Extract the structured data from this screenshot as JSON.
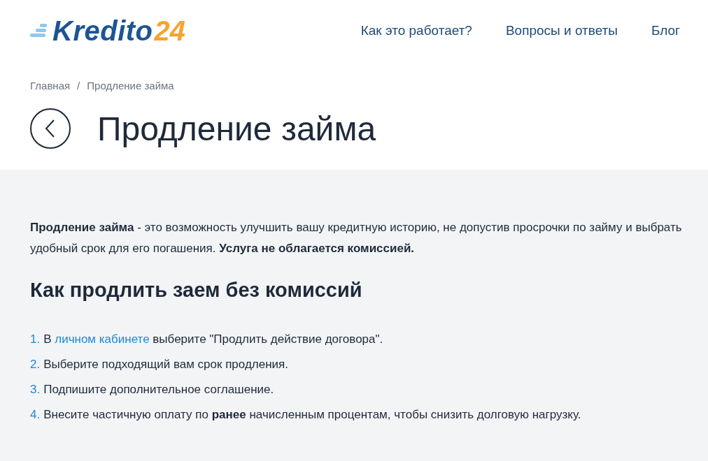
{
  "logo": {
    "word": "Kredito",
    "number": "24"
  },
  "nav": [
    "Как это работает?",
    "Вопросы и ответы",
    "Блог"
  ],
  "breadcrumbs": [
    {
      "label": "Главная"
    },
    {
      "label": "Продление займа"
    }
  ],
  "breadcrumb_separator": "/",
  "title": "Продление займа",
  "intro": "**Продление займа** - это возможность улучшить вашу кредитную историю, не допустив просрочки по займу и выбрать удобный срок для его погашения. **Услуга не облагается комиссией.**",
  "heading": "Как продлить заем без комиссий",
  "steps": [
    {
      "number": "1.",
      "parts": [
        {
          "kind": "text",
          "text": "В "
        },
        {
          "kind": "link",
          "text": "личном кабинете"
        },
        {
          "kind": "text",
          "text": " выберите \"Продлить действие договора\"."
        }
      ]
    },
    {
      "number": "2.",
      "parts": [
        {
          "kind": "text",
          "text": "Выберите подходящий вам срок продления."
        }
      ]
    },
    {
      "number": "3.",
      "parts": [
        {
          "kind": "text",
          "text": "Подпишите дополнительное соглашение."
        }
      ]
    },
    {
      "number": "4.",
      "parts": [
        {
          "kind": "text",
          "text": "Внесите частичную оплату по **ранее** начисленным процентам, чтобы снизить долговую нагрузку."
        }
      ]
    }
  ]
}
